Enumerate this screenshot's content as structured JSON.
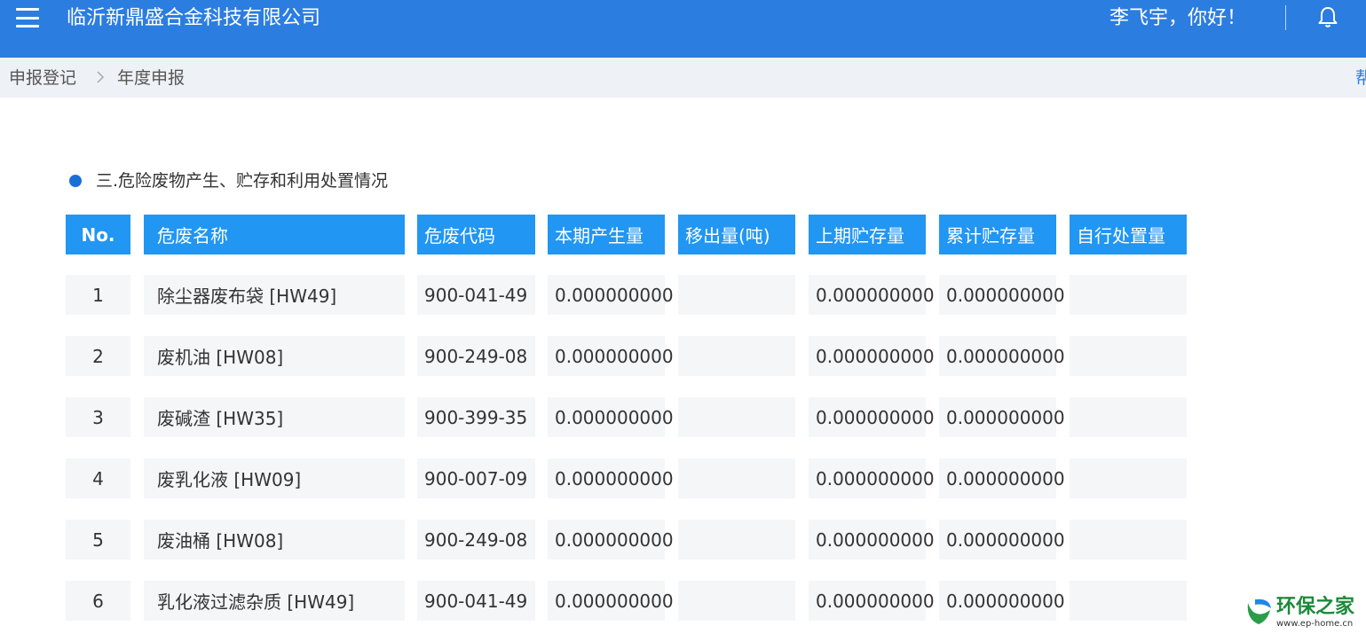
{
  "header": {
    "company": "临沂新鼎盛合金科技有限公司",
    "greeting": "李飞宇，你好！"
  },
  "breadcrumb": {
    "items": [
      "申报登记",
      "年度申报"
    ],
    "help_partial": "帮"
  },
  "section": {
    "title": "三.危险废物产生、贮存和利用处置情况"
  },
  "table": {
    "columns": [
      "No.",
      "危废名称",
      "危废代码",
      "本期产生量",
      "移出量(吨)",
      "上期贮存量",
      "累计贮存量",
      "自行处置量"
    ],
    "rows": [
      {
        "no": "1",
        "name": "除尘器废布袋 [HW49]",
        "code": "900-041-49",
        "current": "0.000000000",
        "out": "",
        "prev": "0.000000000",
        "acc": "0.000000000",
        "self": ""
      },
      {
        "no": "2",
        "name": "废机油 [HW08]",
        "code": "900-249-08",
        "current": "0.000000000",
        "out": "",
        "prev": "0.000000000",
        "acc": "0.000000000",
        "self": ""
      },
      {
        "no": "3",
        "name": "废碱渣 [HW35]",
        "code": "900-399-35",
        "current": "0.000000000",
        "out": "",
        "prev": "0.000000000",
        "acc": "0.000000000",
        "self": ""
      },
      {
        "no": "4",
        "name": "废乳化液 [HW09]",
        "code": "900-007-09",
        "current": "0.000000000",
        "out": "",
        "prev": "0.000000000",
        "acc": "0.000000000",
        "self": ""
      },
      {
        "no": "5",
        "name": "废油桶 [HW08]",
        "code": "900-249-08",
        "current": "0.000000000",
        "out": "",
        "prev": "0.000000000",
        "acc": "0.000000000",
        "self": ""
      },
      {
        "no": "6",
        "name": "乳化液过滤杂质 [HW49]",
        "code": "900-041-49",
        "current": "0.000000000",
        "out": "",
        "prev": "0.000000000",
        "acc": "0.000000000",
        "self": ""
      }
    ]
  },
  "watermark": {
    "name": "环保之家",
    "url": "www.ep-home.cn"
  },
  "icons": {
    "menu": "menu-icon",
    "bell": "bell-icon",
    "breadcrumb_separator": "chevron-right-icon",
    "section_marker": "bullet-dot-icon"
  },
  "colors": {
    "header_bg": "#2b7de0",
    "table_header_bg": "#2196f3",
    "row_bg": "#f4f6f8",
    "breadcrumb_bg": "#eef1f5"
  }
}
